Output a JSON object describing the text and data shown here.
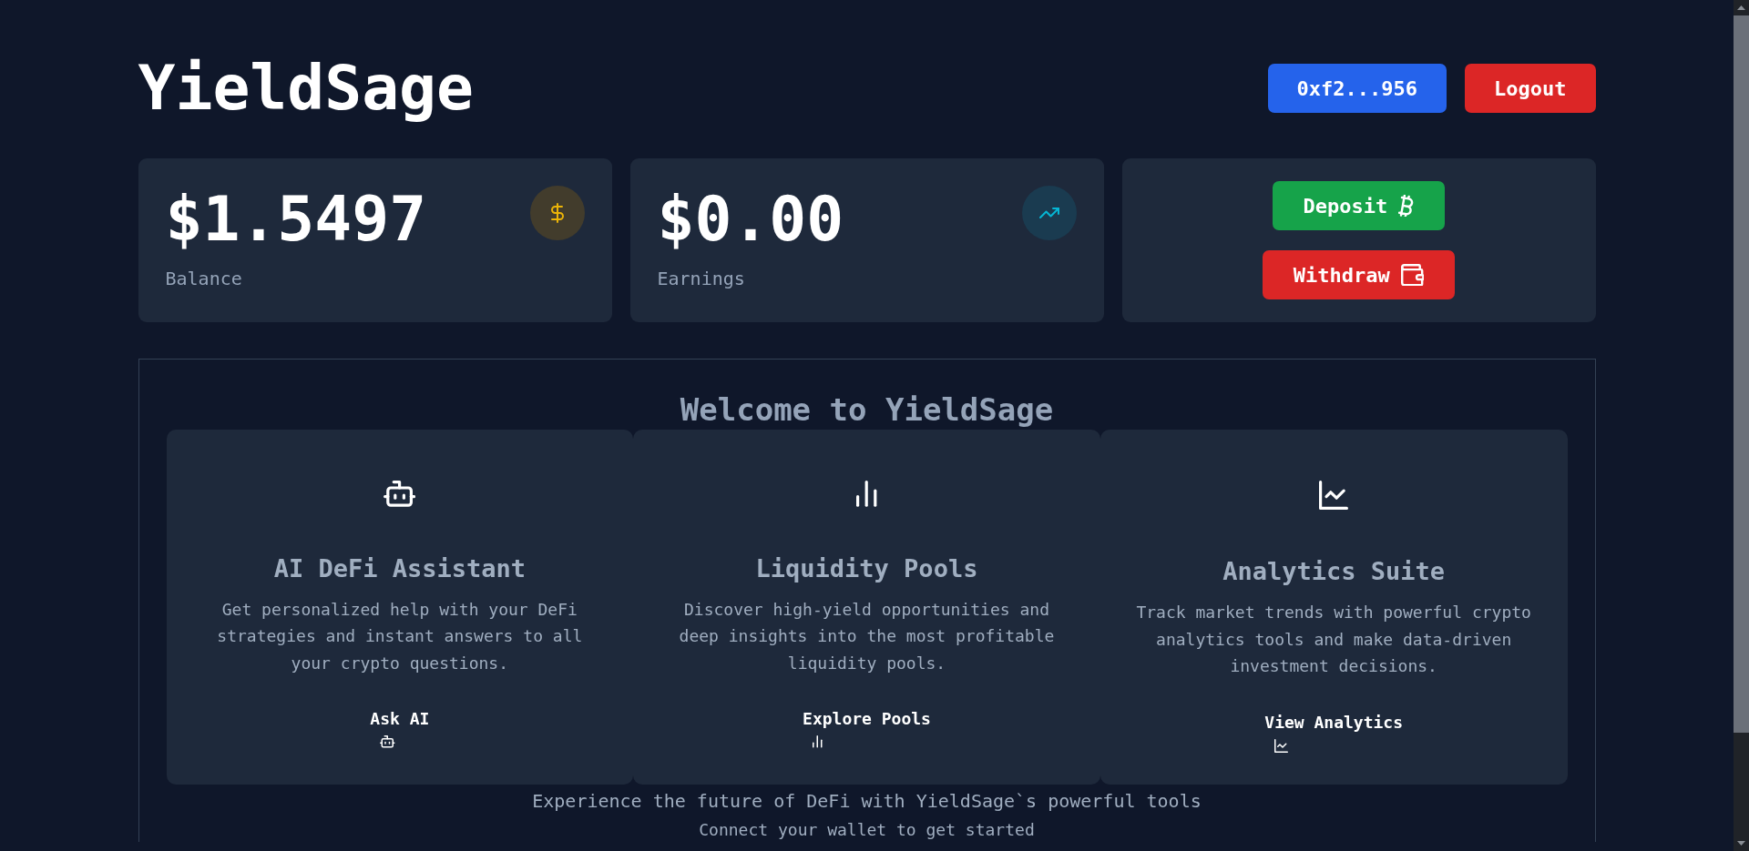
{
  "header": {
    "title": "YieldSage",
    "wallet_address": "0xf2...956",
    "logout": "Logout"
  },
  "stats": [
    {
      "kind": "balance",
      "value": "$1.5497",
      "label": "Balance"
    },
    {
      "kind": "earnings",
      "value": "$0.00",
      "label": "Earnings"
    }
  ],
  "actions": [
    {
      "kind": "deposit",
      "label": "Deposit"
    },
    {
      "kind": "withdraw",
      "label": "Withdraw"
    }
  ],
  "welcome": {
    "heading": "Welcome to YieldSage",
    "features": [
      {
        "kind": "assistant",
        "title": "AI DeFi Assistant",
        "description": "Get personalized help with your DeFi strategies and instant answers to all your crypto questions.",
        "link": "Ask AI"
      },
      {
        "kind": "pools",
        "title": "Liquidity Pools",
        "description": "Discover high-yield opportunities and deep insights into the most profitable liquidity pools.",
        "link": "Explore Pools"
      },
      {
        "kind": "analytics",
        "title": "Analytics Suite",
        "description": "Track market trends with powerful crypto analytics tools and make data-driven investment decisions.",
        "link": "View Analytics"
      }
    ],
    "tagline": "Experience the future of DeFi with YieldSage`s powerful tools",
    "note": "Connect your wallet to get started"
  }
}
